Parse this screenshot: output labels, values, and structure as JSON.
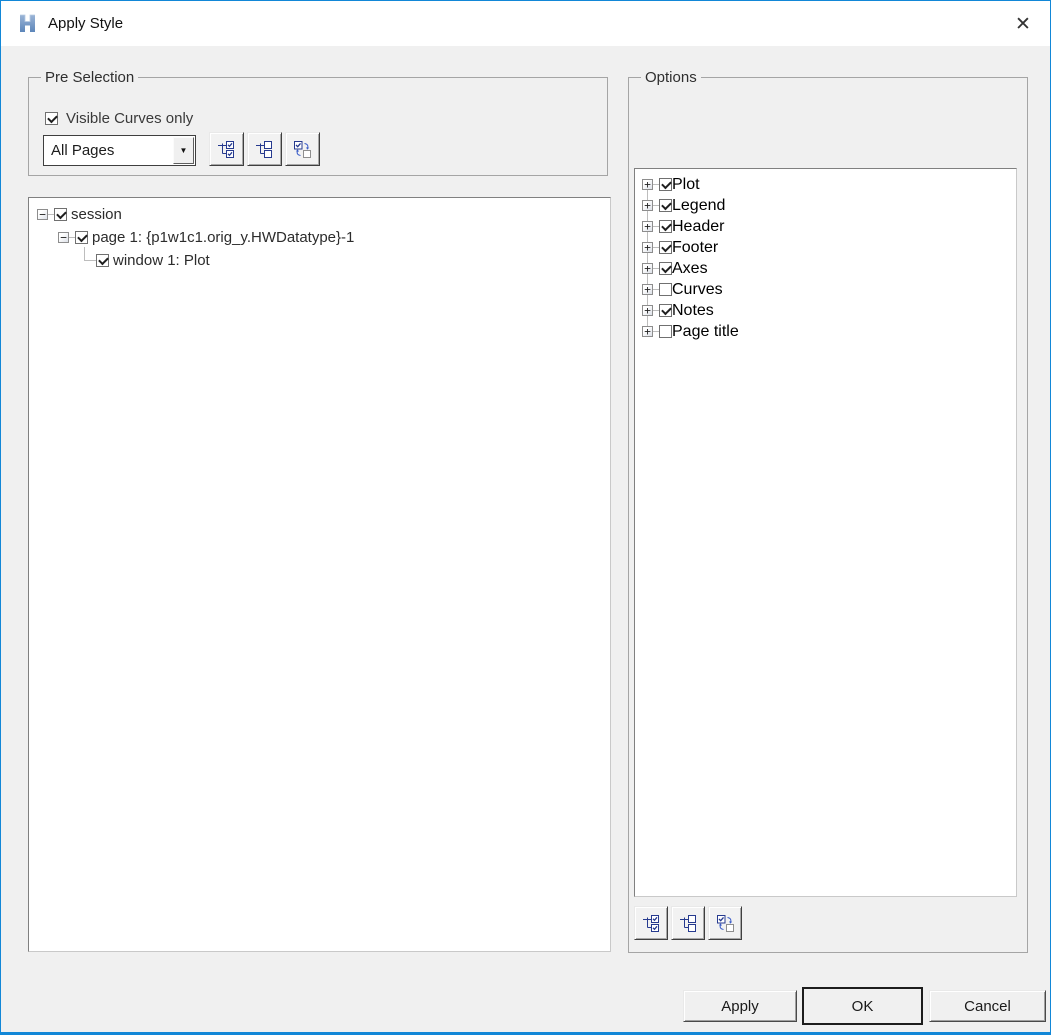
{
  "window": {
    "title": "Apply Style"
  },
  "icons": {
    "close": "✕",
    "dropdown_arrow": "▼",
    "collapse": "−",
    "expand": "+"
  },
  "colors": {
    "window_border": "#1287d7",
    "dialog_bg": "#f0f0f0",
    "titlebar_bg": "#ffffff",
    "tool_icon_navy": "#263a8f",
    "tool_icon_arrow_blue": "#3a5cc8",
    "logo_blue": "#6d92c4"
  },
  "pre_selection": {
    "label": "Pre Selection",
    "visible_curves": {
      "label": "Visible Curves only",
      "checked": true
    },
    "page_scope": {
      "value": "All Pages"
    },
    "tools": [
      {
        "icon": "tree-check-all"
      },
      {
        "icon": "tree-uncheck-all"
      },
      {
        "icon": "invert-selection"
      }
    ]
  },
  "session_tree": {
    "items": [
      {
        "label": "session",
        "checked": true,
        "expand_glyph": "−",
        "level": 0
      },
      {
        "label": "page 1: {p1w1c1.orig_y.HWDatatype}-1",
        "checked": true,
        "expand_glyph": "−",
        "level": 1
      },
      {
        "label": "window 1: Plot",
        "checked": true,
        "level": 2
      }
    ]
  },
  "options": {
    "label": "Options",
    "items": [
      {
        "label": "Plot",
        "checked": true,
        "expand_glyph": "+"
      },
      {
        "label": "Legend",
        "checked": true,
        "expand_glyph": "+"
      },
      {
        "label": "Header",
        "checked": true,
        "expand_glyph": "+"
      },
      {
        "label": "Footer",
        "checked": true,
        "expand_glyph": "+"
      },
      {
        "label": "Axes",
        "checked": true,
        "expand_glyph": "+"
      },
      {
        "label": "Curves",
        "checked": false,
        "expand_glyph": "+"
      },
      {
        "label": "Notes",
        "checked": true,
        "expand_glyph": "+"
      },
      {
        "label": "Page title",
        "checked": false,
        "expand_glyph": "+"
      }
    ],
    "tools": [
      {
        "icon": "tree-check-all"
      },
      {
        "icon": "tree-uncheck-all"
      },
      {
        "icon": "invert-selection"
      }
    ]
  },
  "footer": {
    "apply": "Apply",
    "ok": "OK",
    "cancel": "Cancel"
  }
}
